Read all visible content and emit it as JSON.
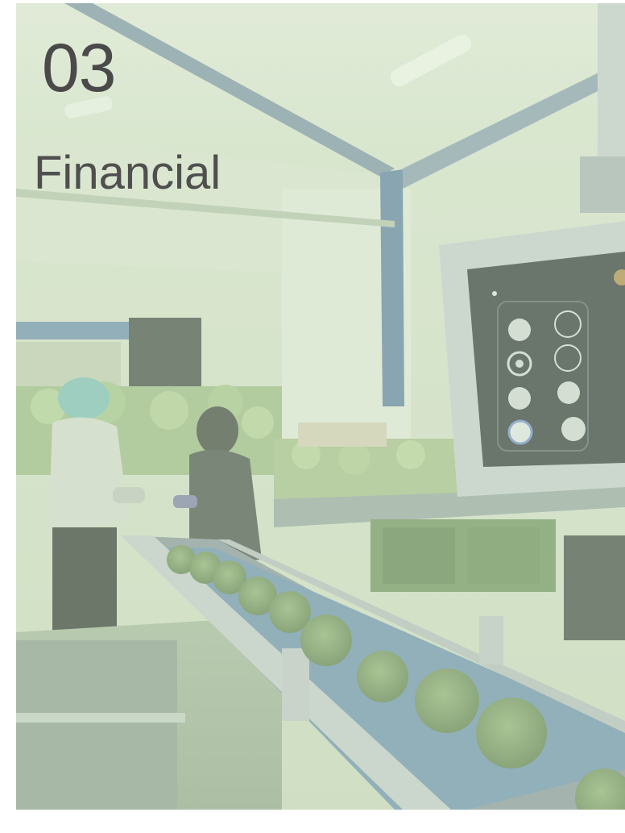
{
  "section": {
    "number": "03",
    "title": "Financial"
  },
  "image": {
    "subject": "broccoli-processing-conveyor",
    "panel_icon": "control-panel-icon"
  },
  "colors": {
    "tint": "#d2e4c4",
    "text": "#4a4a4a",
    "steel_blue": "#5e7fa6",
    "conveyor_blue": "#6a90b4",
    "broccoli": "#6f8f5a"
  }
}
